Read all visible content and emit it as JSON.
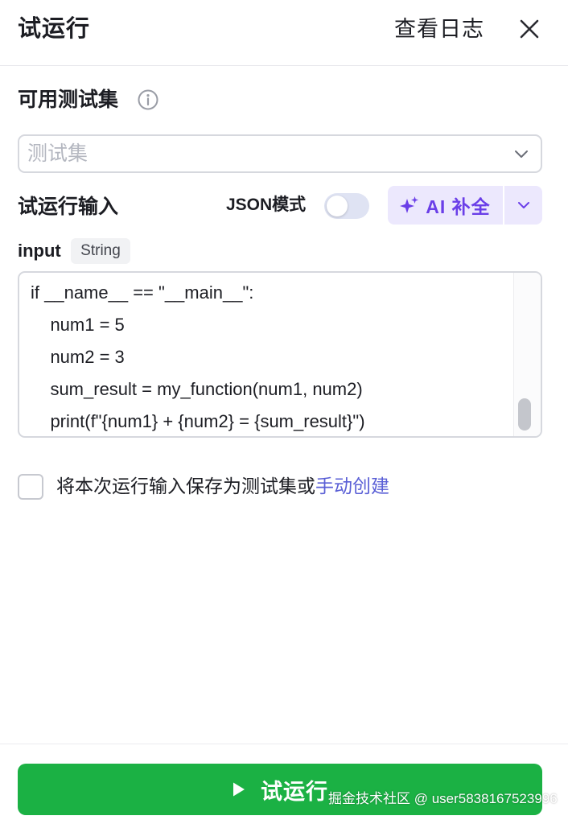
{
  "header": {
    "title": "试运行",
    "log_label": "查看日志"
  },
  "test_set": {
    "label": "可用测试集",
    "placeholder": "测试集"
  },
  "run_input": {
    "label": "试运行输入",
    "json_mode_label": "JSON模式",
    "json_mode_on": false,
    "ai_complete_label": "AI 补全"
  },
  "param": {
    "name": "input",
    "type": "String",
    "code_lines": [
      "if __name__ == \"__main__\":",
      "    num1 = 5",
      "    num2 = 3",
      "    sum_result = my_function(num1, num2)",
      "    print(f\"{num1} + {num2} = {sum_result}\")"
    ]
  },
  "save_option": {
    "text": "将本次运行输入保存为测试集或",
    "link": "手动创建",
    "checked": false
  },
  "footer": {
    "run_label": "试运行",
    "watermark": "掘金技术社区 @ user5838167523996"
  },
  "colors": {
    "primary_green": "#1bb144",
    "ai_purple": "#6a3ee8",
    "link_blue": "#5a5fd6"
  }
}
